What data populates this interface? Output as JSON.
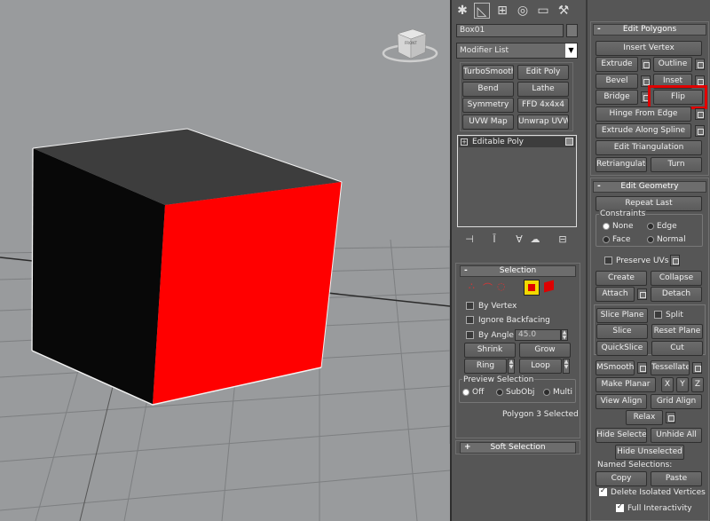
{
  "viewport": {
    "viewcube_label": "FRONT"
  },
  "tabs": [
    "create-icon",
    "modify-icon",
    "hierarchy-icon",
    "motion-icon",
    "display-icon",
    "utilities-icon"
  ],
  "object_name": "Box01",
  "modifier_list": "Modifier List",
  "modifier_buttons": [
    "TurboSmooth",
    "Edit Poly",
    "Bend",
    "Lathe",
    "Symmetry",
    "FFD 4x4x4",
    "UVW Map",
    "Unwrap UVW"
  ],
  "stack": {
    "item": "Editable Poly"
  },
  "selection": {
    "title": "Selection",
    "by_vertex": "By Vertex",
    "ignore_backfacing": "Ignore Backfacing",
    "by_angle": "By Angle:",
    "angle_value": "45.0",
    "shrink": "Shrink",
    "grow": "Grow",
    "ring": "Ring",
    "loop": "Loop",
    "preview_title": "Preview Selection",
    "preview_options": [
      "Off",
      "SubObj",
      "Multi"
    ],
    "status": "Polygon 3 Selected"
  },
  "soft_selection": {
    "title": "Soft Selection"
  },
  "edit_polygons": {
    "title": "Edit Polygons",
    "insert_vertex": "Insert Vertex",
    "extrude": "Extrude",
    "outline": "Outline",
    "bevel": "Bevel",
    "inset": "Inset",
    "bridge": "Bridge",
    "flip": "Flip",
    "hinge": "Hinge From Edge",
    "extrude_spline": "Extrude Along Spline",
    "edit_triangulation": "Edit Triangulation",
    "retriangulate": "Retriangulate",
    "turn": "Turn"
  },
  "edit_geometry": {
    "title": "Edit Geometry",
    "repeat_last": "Repeat Last",
    "constraints": "Constraints",
    "none": "None",
    "edge": "Edge",
    "face": "Face",
    "normal": "Normal",
    "preserve_uvs": "Preserve UVs",
    "create": "Create",
    "collapse": "Collapse",
    "attach": "Attach",
    "detach": "Detach",
    "slice_plane": "Slice Plane",
    "split": "Split",
    "slice": "Slice",
    "reset_plane": "Reset Plane",
    "quickslice": "QuickSlice",
    "cut": "Cut",
    "msmooth": "MSmooth",
    "tessellate": "Tessellate",
    "make_planar": "Make Planar",
    "x": "X",
    "y": "Y",
    "z": "Z",
    "view_align": "View Align",
    "grid_align": "Grid Align",
    "relax": "Relax",
    "hide_selected": "Hide Selected",
    "unhide_all": "Unhide All",
    "hide_unselected": "Hide Unselected",
    "named_selections": "Named Selections:",
    "copy": "Copy",
    "paste": "Paste",
    "delete_isolated": "Delete Isolated Vertices",
    "full_interactivity": "Full Interactivity"
  },
  "colors": {
    "highlight": "#e00000",
    "selected_face": "#ff0000",
    "cube_dark": "#0a0a0a"
  }
}
